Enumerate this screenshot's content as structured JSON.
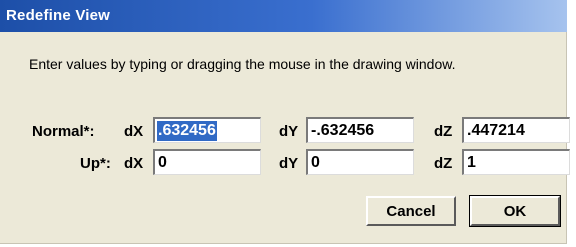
{
  "dialog": {
    "title": "Redefine View",
    "instruction": "Enter values by typing or dragging the mouse in the drawing window."
  },
  "normal": {
    "label": "Normal*:",
    "dx_label": "dX",
    "dy_label": "dY",
    "dz_label": "dZ",
    "dx": ".632456",
    "dy": "-.632456",
    "dz": ".447214"
  },
  "up": {
    "label": "Up*:",
    "dx_label": "dX",
    "dy_label": "dY",
    "dz_label": "dZ",
    "dx": "0",
    "dy": "0",
    "dz": "1"
  },
  "buttons": {
    "cancel": "Cancel",
    "ok": "OK"
  },
  "colors": {
    "title_bar": "#1d4fa8",
    "dialog_bg": "#ece9d8",
    "selection": "#316ac5"
  }
}
